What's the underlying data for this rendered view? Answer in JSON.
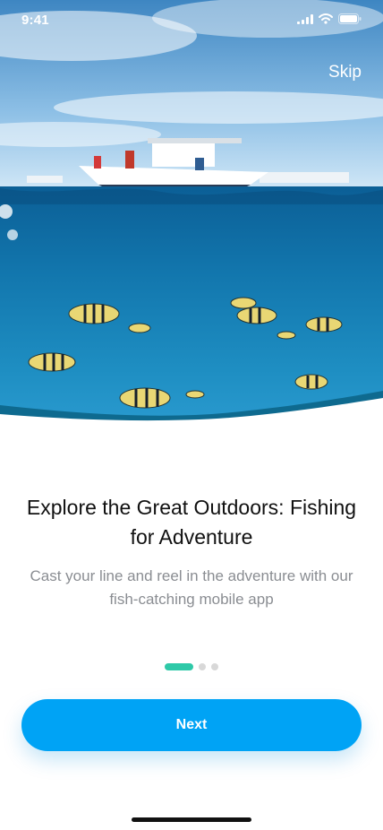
{
  "status_bar": {
    "time": "9:41"
  },
  "header": {
    "skip_label": "Skip"
  },
  "onboarding": {
    "title": "Explore the Great Outdoors: Fishing for Adventure",
    "subtitle": "Cast your line and reel in the adventure with our fish-catching mobile app",
    "pages_total": 3,
    "active_page": 1
  },
  "actions": {
    "next_label": "Next"
  },
  "colors": {
    "accent": "#00a3f5",
    "indicator_active": "#2ec9a8",
    "indicator_inactive": "#d8d8d8"
  }
}
